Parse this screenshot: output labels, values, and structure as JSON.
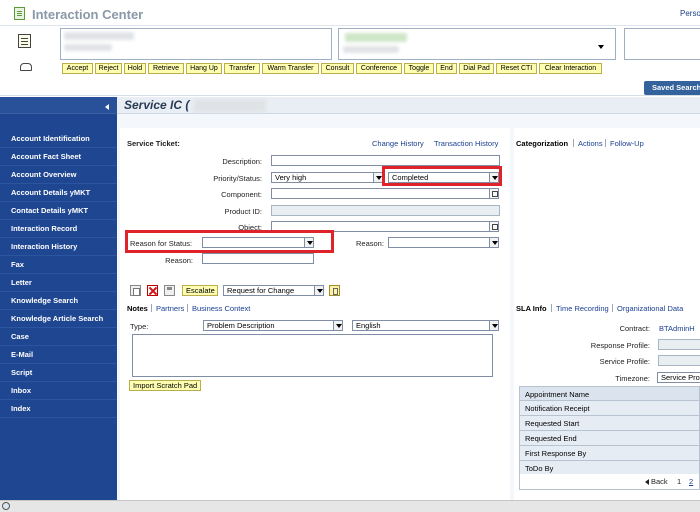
{
  "app": {
    "title": "Interaction Center",
    "person_link": "Perso"
  },
  "cti_buttons": [
    "Accept",
    "Reject",
    "Hold",
    "Retrieve",
    "Hang Up",
    "Transfer",
    "Warm Transfer",
    "Consult",
    "Conference",
    "Toggle",
    "End",
    "Dial Pad",
    "Reset CTI",
    "Clear Interaction"
  ],
  "saved_search": "Saved Search",
  "sidebar": {
    "items": [
      "Account Identification",
      "Account Fact Sheet",
      "Account Overview",
      "Account Details yMKT",
      "Contact Details yMKT",
      "Interaction Record",
      "Interaction History",
      "Fax",
      "Letter",
      "Knowledge Search",
      "Knowledge Article Search",
      "Case",
      "E-Mail",
      "Script",
      "Inbox",
      "Index"
    ]
  },
  "page": {
    "title": "Service IC ("
  },
  "ticket": {
    "header": "Service Ticket:",
    "links": {
      "change_history": "Change History",
      "transaction_history": "Transaction History"
    },
    "labels": {
      "description": "Description:",
      "priority_status": "Priority/Status:",
      "component": "Component:",
      "product_id": "Product ID:",
      "object": "Object:",
      "reason_for_status": "Reason for Status:",
      "reason_right": "Reason:",
      "reason": "Reason:"
    },
    "values": {
      "description": "",
      "priority": "Very high",
      "status": "Completed",
      "component": "",
      "product_id": "",
      "object": "",
      "reason_for_status": "",
      "reason_right": "",
      "reason": ""
    }
  },
  "toolbar": {
    "escalate": "Escalate",
    "change_type": "Request for Change"
  },
  "notes": {
    "tabs": [
      "Notes",
      "Partners",
      "Business Context"
    ],
    "type_label": "Type:",
    "type_value": "Problem Description",
    "language_value": "English",
    "text": "",
    "import_button": "Import Scratch Pad"
  },
  "categorization": {
    "tabs": [
      "Categorization",
      "Actions",
      "Follow-Up"
    ]
  },
  "sla": {
    "tabs": [
      "SLA Info",
      "Time Recording",
      "Organizational Data"
    ],
    "contract_label": "Contract:",
    "contract_value": "BTAdminH",
    "response_profile_label": "Response Profile:",
    "service_profile_label": "Service Profile:",
    "timezone_label": "Timezone:",
    "timezone_value": "Service Pro",
    "appointments_header": "Appointment Name",
    "appointments": [
      "Notification Receipt",
      "Requested Start",
      "Requested End",
      "First Response By",
      "ToDo By"
    ],
    "pager": {
      "back": "Back",
      "page1": "1",
      "page2": "2"
    }
  }
}
